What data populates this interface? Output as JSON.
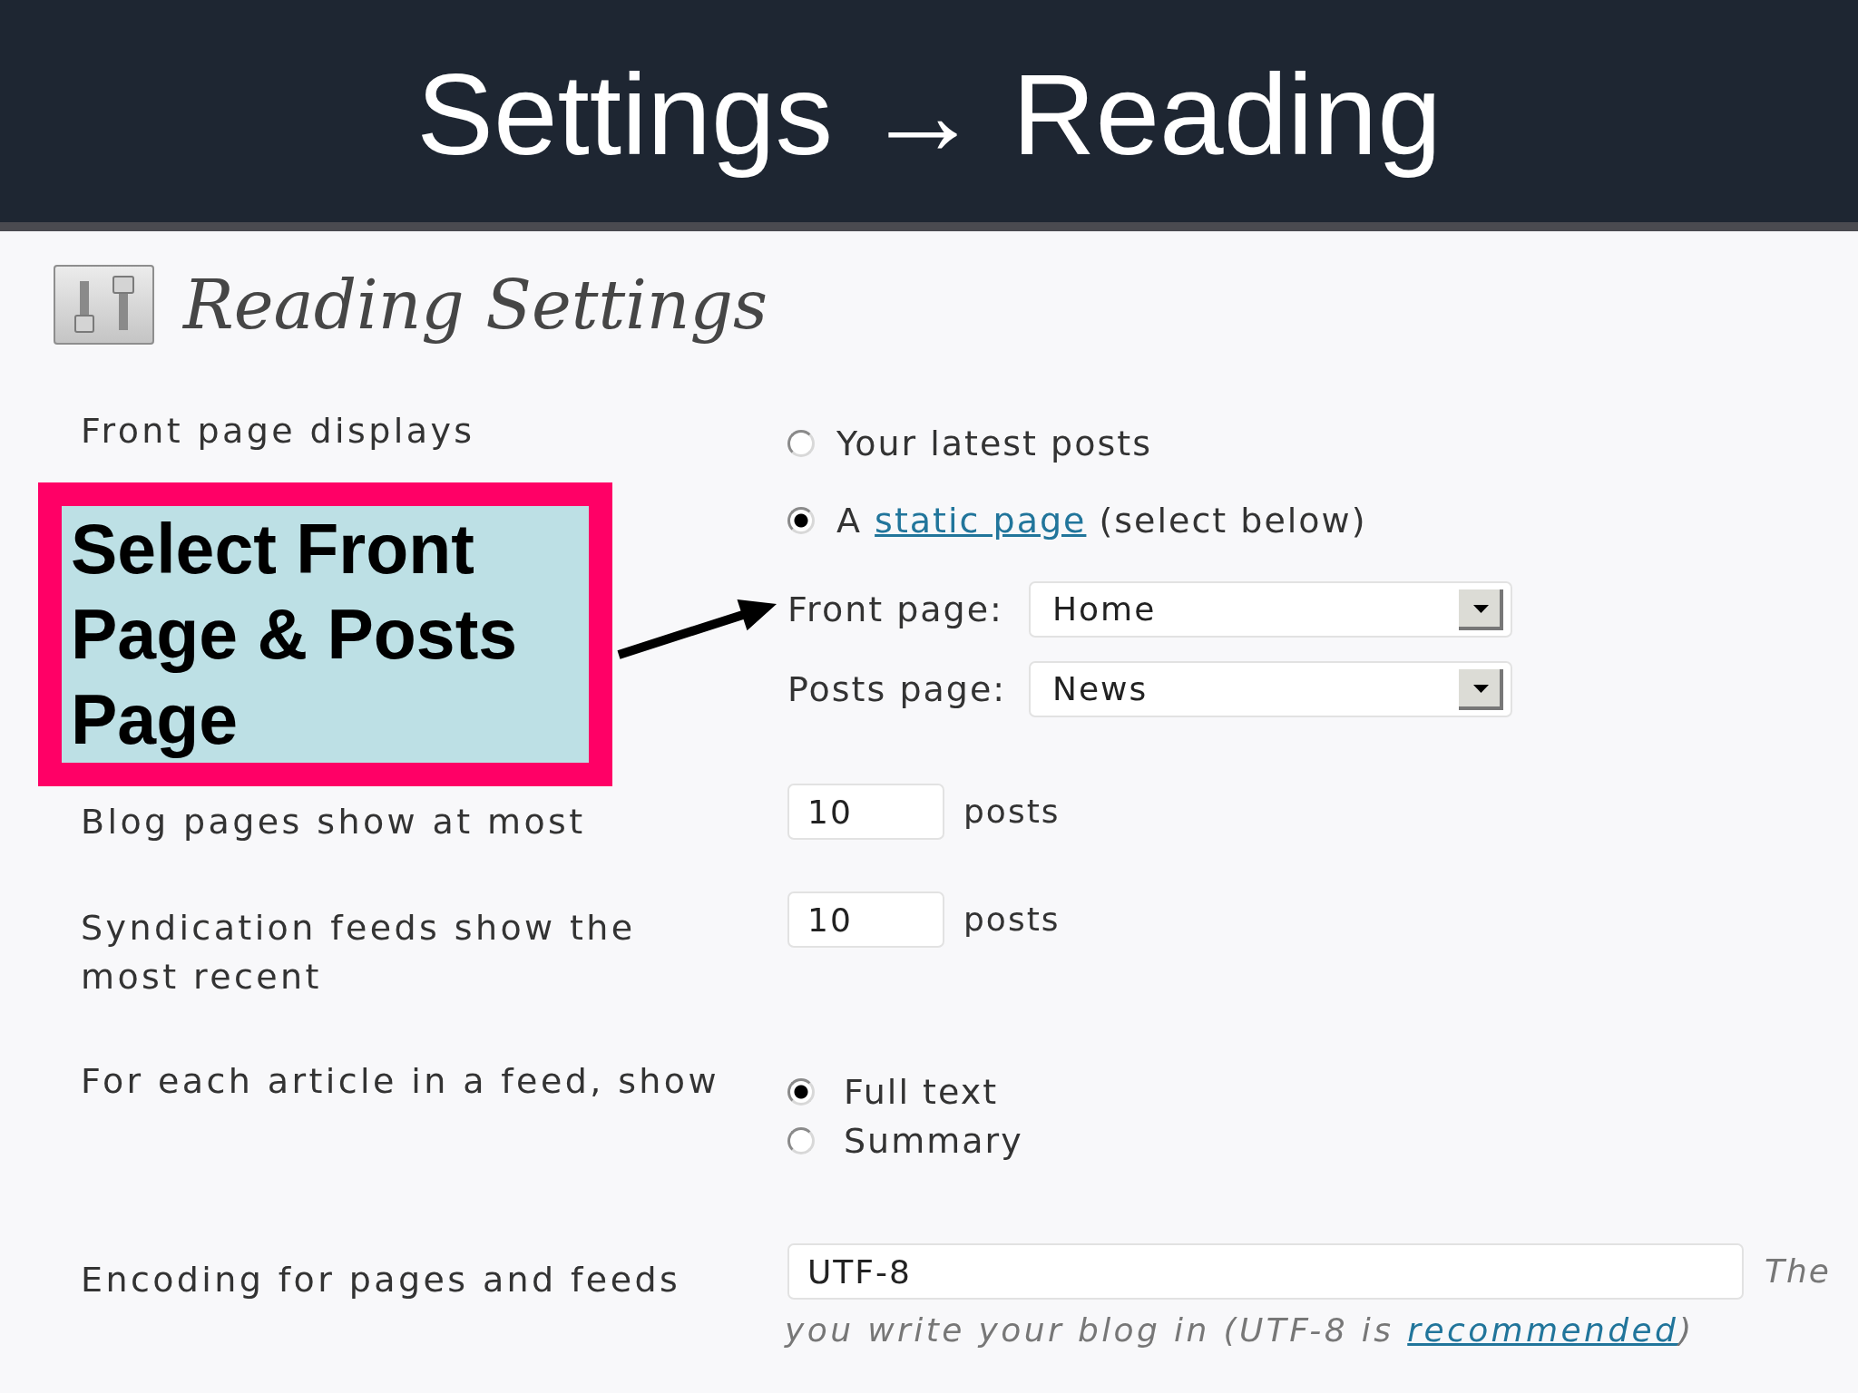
{
  "slide": {
    "title": "Settings → Reading"
  },
  "page": {
    "heading": "Reading Settings"
  },
  "settings": [
    {
      "kind": "radio",
      "label": "Front page displays",
      "options": [
        {
          "label": "Your latest posts",
          "selected": false
        },
        {
          "label": "A",
          "link": "static page",
          "label_after": "(select below)",
          "selected": true
        }
      ],
      "dropdowns": [
        {
          "label": "Front page:",
          "value": "Home"
        },
        {
          "label": "Posts page:",
          "value": "News"
        }
      ]
    },
    {
      "kind": "number",
      "label": "Blog pages show at most",
      "value": "10",
      "unit": "posts"
    },
    {
      "kind": "number",
      "label": "Syndication feeds show the most recent",
      "value": "10",
      "unit": "posts"
    },
    {
      "kind": "radio",
      "label": "For each article in a feed, show",
      "options": [
        {
          "label": "Full text",
          "selected": true
        },
        {
          "label": "Summary",
          "selected": false
        }
      ]
    },
    {
      "kind": "text",
      "label": "Encoding for pages and feeds",
      "value": "UTF-8",
      "description": "The",
      "note": {
        "text": "you write your blog in (UTF-8 is",
        "link": "recommended",
        "text_after": ")"
      }
    }
  ],
  "callout": {
    "text": "Select Front Page & Posts Page"
  }
}
